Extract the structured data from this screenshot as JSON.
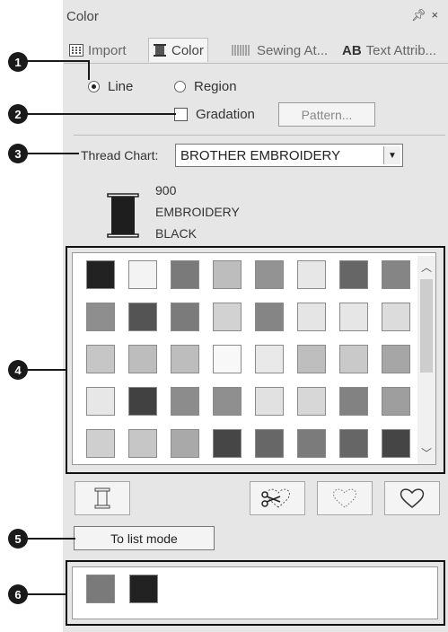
{
  "panel": {
    "title": "Color",
    "pin_icon": "pin-icon",
    "close_icon": "close-icon"
  },
  "tabs": [
    {
      "label": "Import",
      "icon": "grid-icon"
    },
    {
      "label": "Color",
      "icon": "spool-icon",
      "active": true
    },
    {
      "label": "Sewing At...",
      "icon": "stitch-icon"
    },
    {
      "label": "Text Attrib...",
      "icon": "ab-icon",
      "icon_text": "AB"
    }
  ],
  "mode": {
    "line_label": "Line",
    "region_label": "Region",
    "selected": "Line"
  },
  "gradation": {
    "label": "Gradation",
    "checked": false,
    "pattern_button": "Pattern..."
  },
  "thread_chart": {
    "label": "Thread Chart:",
    "value": "BROTHER EMBROIDERY"
  },
  "current_thread": {
    "number": "900",
    "brand": "EMBROIDERY",
    "name": "BLACK",
    "color": "#1e1e1e"
  },
  "palette": [
    [
      "#222222",
      "#f3f3f3",
      "#7a7a7a",
      "#bdbdbd",
      "#939393",
      "#e7e7e7",
      "#666666",
      "#858585"
    ],
    [
      "#8e8e8e",
      "#545454",
      "#7b7b7b",
      "#d2d2d2",
      "#858585",
      "#e5e5e5",
      "#e6e6e6",
      "#dcdcdc"
    ],
    [
      "#c6c6c6",
      "#bdbdbd",
      "#bdbdbd",
      "#f8f8f8",
      "#e9e9e9",
      "#bebebe",
      "#c9c9c9",
      "#a6a6a6"
    ],
    [
      "#e7e7e7",
      "#414141",
      "#8c8c8c",
      "#8f8f8f",
      "#e1e1e1",
      "#d7d7d7",
      "#828282",
      "#9e9e9e"
    ],
    [
      "#cfcfcf",
      "#c6c6c6",
      "#a9a9a9",
      "#464646",
      "#676767",
      "#7b7b7b",
      "#666666",
      "#454545"
    ]
  ],
  "list_mode_button": "To list mode",
  "used_colors": [
    "#7a7a7a",
    "#222222"
  ],
  "callouts": [
    "1",
    "2",
    "3",
    "4",
    "5",
    "6"
  ]
}
